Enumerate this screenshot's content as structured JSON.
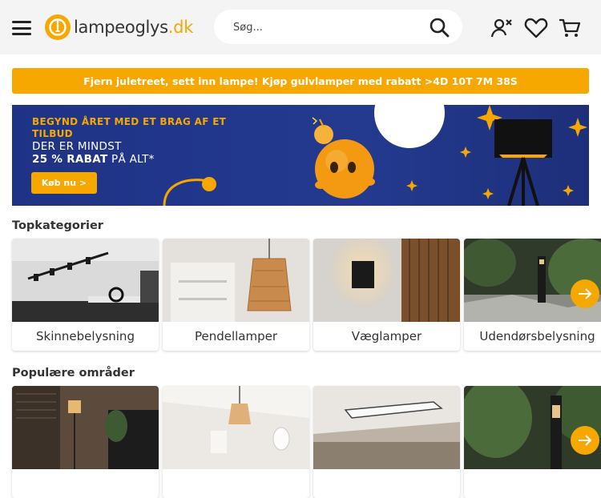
{
  "header": {
    "logo_text_main": "lampeoglys",
    "logo_text_tld": ".dk",
    "search_placeholder": "Søg..."
  },
  "promo_bar": {
    "text": "Fjern juletreet, sett inn lampe! Kjøp gulvlamper med rabatt >4D 10T 7M 38S"
  },
  "hero": {
    "kicker": "BEGYND ÅRET MED ET BRAG AF ET TILBUD",
    "line1": "DER ER MINDST",
    "line2_bold": "25 % RABAT",
    "line2_rest": " PÅ ALT*",
    "button_label": "Køb nu >"
  },
  "top_categories": {
    "title": "Topkategorier",
    "items": [
      {
        "label": "Skinnebelysning"
      },
      {
        "label": "Pendellamper"
      },
      {
        "label": "Væglamper"
      },
      {
        "label": "Udendørsbelysning"
      }
    ]
  },
  "popular_areas": {
    "title": "Populære områder"
  },
  "colors": {
    "accent": "#f6a800",
    "hero_bg": "#233a8f",
    "header_bg": "#f4f4f4"
  }
}
